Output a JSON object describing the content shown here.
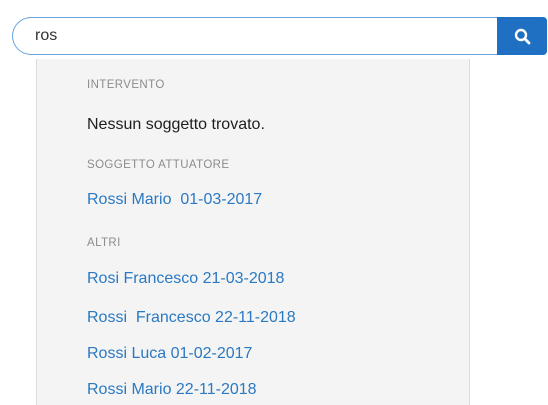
{
  "search": {
    "value": "ros",
    "button_icon": "search-icon"
  },
  "colors": {
    "accent": "#1f6fc3",
    "link": "#2a79c2",
    "dropdown_bg": "#f4f4f4"
  },
  "dropdown": {
    "sections": [
      {
        "header": "INTERVENTO",
        "empty_message": "Nessun soggetto trovato."
      },
      {
        "header": "SOGGETTO ATTUATORE",
        "items": [
          "Rossi Mario  01-03-2017"
        ]
      },
      {
        "header": "ALTRI",
        "items": [
          "Rosi Francesco 21-03-2018",
          "Rossi  Francesco 22-11-2018",
          "Rossi Luca 01-02-2017",
          "Rossi Mario 22-11-2018"
        ]
      }
    ]
  }
}
